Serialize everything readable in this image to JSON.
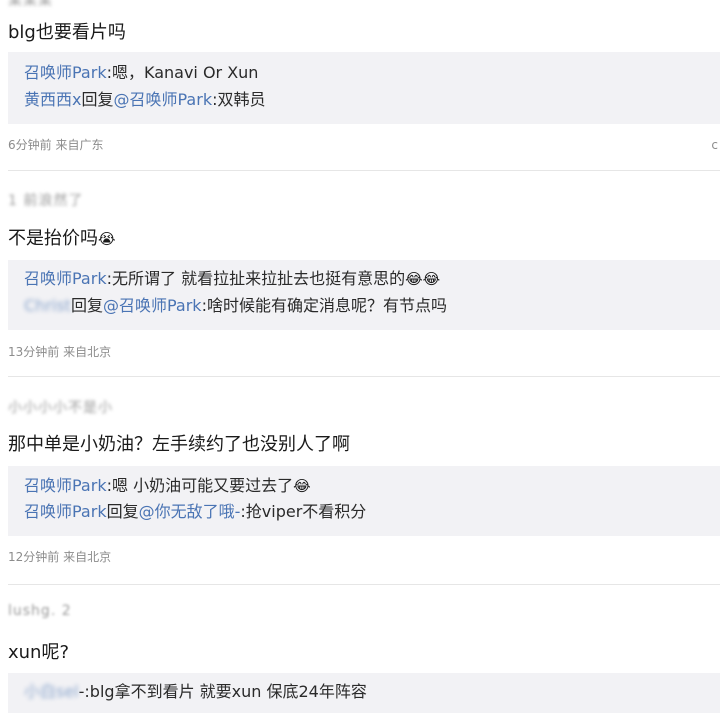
{
  "posts": [
    {
      "author": "",
      "content": "blg也要看片吗",
      "replies": [
        {
          "user": "召唤师Park",
          "text": ":嗯，Kanavi Or Xun"
        },
        {
          "user": "黄西西x",
          "mid": "回复",
          "target": "@召唤师Park",
          "text": ":双韩员"
        }
      ],
      "time": "6分钟前",
      "location": "来自广东"
    },
    {
      "author": "1 前浪然了",
      "content": "不是抬价吗",
      "content_emoji": "😭",
      "replies": [
        {
          "user": "召唤师Park",
          "text": ":无所谓了 就看拉扯来拉扯去也挺有意思的",
          "emoji": "😂😂"
        },
        {
          "user": "Christ",
          "mid": "回复",
          "target": "@召唤师Park",
          "text": ":啥时候能有确定消息呢？有节点吗"
        }
      ],
      "time": "13分钟前",
      "location": "来自北京"
    },
    {
      "author": "小小小小不是小",
      "content": "那中单是小奶油？左手续约了也没别人了啊",
      "replies": [
        {
          "user": "召唤师Park",
          "text": ":嗯 小奶油可能又要过去了",
          "emoji": "😂"
        },
        {
          "user": "召唤师Park",
          "mid": "回复",
          "target": "@你无敌了哦-",
          "text": ":抢viper不看积分"
        }
      ],
      "time": "12分钟前",
      "location": "来自北京"
    },
    {
      "author": "lushg. 2",
      "content": "xun呢?",
      "replies": [
        {
          "user": "小白sel",
          "text": "-:blg拿不到看片 就要xun 保底24年阵容"
        }
      ]
    }
  ],
  "edge_char": "c"
}
